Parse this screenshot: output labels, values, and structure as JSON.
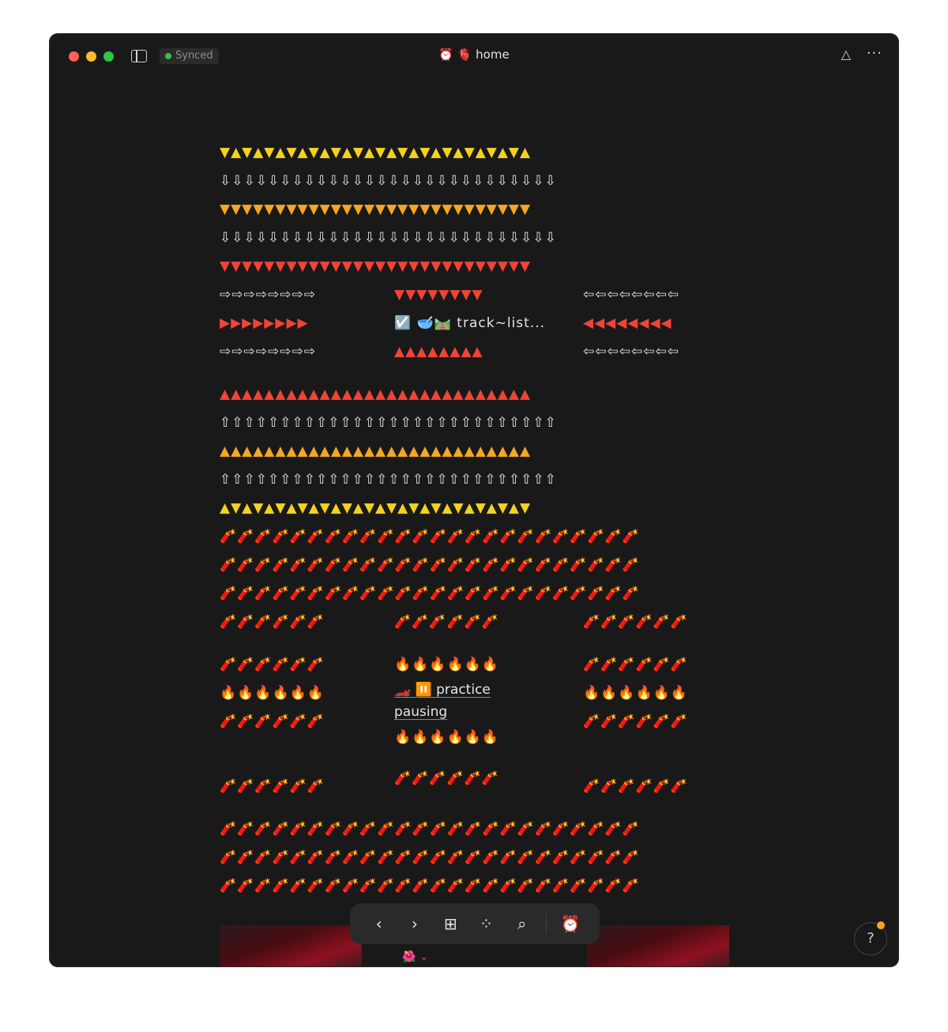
{
  "window": {
    "sync_status": "Synced",
    "title": "⏰ 🫀 home",
    "graph_icon": "△",
    "more_icon": "···"
  },
  "rows_top": [
    {
      "color": "yellow",
      "text": "▼▲▼▲▼▲▼▲▼▲▼▲▼▲▼▲▼▲▼▲▼▲▼▲▼▲▼▲"
    },
    {
      "color": "white",
      "text": "⇩⇩⇩⇩⇩⇩⇩⇩⇩⇩⇩⇩⇩⇩⇩⇩⇩⇩⇩⇩⇩⇩⇩⇩⇩⇩⇩⇩"
    },
    {
      "color": "orange",
      "text": "▼▼▼▼▼▼▼▼▼▼▼▼▼▼▼▼▼▼▼▼▼▼▼▼▼▼▼▼"
    },
    {
      "color": "white",
      "text": "⇩⇩⇩⇩⇩⇩⇩⇩⇩⇩⇩⇩⇩⇩⇩⇩⇩⇩⇩⇩⇩⇩⇩⇩⇩⇩⇩⇩"
    },
    {
      "color": "red",
      "text": "▼▼▼▼▼▼▼▼▼▼▼▼▼▼▼▼▼▼▼▼▼▼▼▼▼▼▼▼"
    }
  ],
  "nav_block": {
    "left": [
      "⇨⇨⇨⇨⇨⇨⇨⇨",
      "▶▶▶▶▶▶▶▶",
      "⇨⇨⇨⇨⇨⇨⇨⇨"
    ],
    "mid_top": "▼▼▼▼▼▼▼▼",
    "mid_link": "☑️ 🥣🛤️ track~list...",
    "mid_bottom": "▲▲▲▲▲▲▲▲",
    "right": [
      "⇦⇦⇦⇦⇦⇦⇦⇦",
      "◀◀◀◀◀◀◀◀",
      "⇦⇦⇦⇦⇦⇦⇦⇦"
    ]
  },
  "rows_mid": [
    {
      "color": "red",
      "text": "▲▲▲▲▲▲▲▲▲▲▲▲▲▲▲▲▲▲▲▲▲▲▲▲▲▲▲▲"
    },
    {
      "color": "white",
      "text": "⇧⇧⇧⇧⇧⇧⇧⇧⇧⇧⇧⇧⇧⇧⇧⇧⇧⇧⇧⇧⇧⇧⇧⇧⇧⇧⇧⇧"
    },
    {
      "color": "orange",
      "text": "▲▲▲▲▲▲▲▲▲▲▲▲▲▲▲▲▲▲▲▲▲▲▲▲▲▲▲▲"
    },
    {
      "color": "white",
      "text": "⇧⇧⇧⇧⇧⇧⇧⇧⇧⇧⇧⇧⇧⇧⇧⇧⇧⇧⇧⇧⇧⇧⇧⇧⇧⇧⇧⇧"
    },
    {
      "color": "yellow",
      "text": "▲▼▲▼▲▼▲▼▲▼▲▼▲▼▲▼▲▼▲▼▲▼▲▼▲▼▲▼"
    },
    {
      "color": "red",
      "text": "🧨🧨🧨🧨🧨🧨🧨🧨🧨🧨🧨🧨🧨🧨🧨🧨🧨🧨🧨🧨🧨🧨🧨🧨"
    },
    {
      "color": "red",
      "text": "🧨🧨🧨🧨🧨🧨🧨🧨🧨🧨🧨🧨🧨🧨🧨🧨🧨🧨🧨🧨🧨🧨🧨🧨"
    },
    {
      "color": "red",
      "text": "🧨🧨🧨🧨🧨🧨🧨🧨🧨🧨🧨🧨🧨🧨🧨🧨🧨🧨🧨🧨🧨🧨🧨🧨"
    }
  ],
  "practice_block": {
    "left": [
      "🧨🧨🧨🧨🧨🧨",
      "",
      "🧨🧨🧨🧨🧨🧨",
      "🔥🔥🔥🔥🔥🔥",
      "🧨🧨🧨🧨🧨🧨",
      "",
      "🧨🧨🧨🧨🧨🧨"
    ],
    "mid_top": "🧨🧨🧨🧨🧨🧨",
    "mid_fire_top": "🔥🔥🔥🔥🔥🔥",
    "mid_link_1": "🏎️ ⏸️ practice",
    "mid_link_2": "pausing",
    "mid_fire_bottom": "🔥🔥🔥🔥🔥🔥",
    "mid_bottom": "🧨🧨🧨🧨🧨🧨",
    "right": [
      "🧨🧨🧨🧨🧨🧨",
      "",
      "🧨🧨🧨🧨🧨🧨",
      "🔥🔥🔥🔥🔥🔥",
      "🧨🧨🧨🧨🧨🧨",
      "",
      "🧨🧨🧨🧨🧨🧨"
    ]
  },
  "rows_bottom": [
    {
      "color": "red",
      "text": "🧨🧨🧨🧨🧨🧨🧨🧨🧨🧨🧨🧨🧨🧨🧨🧨🧨🧨🧨🧨🧨🧨🧨🧨"
    },
    {
      "color": "red",
      "text": "🧨🧨🧨🧨🧨🧨🧨🧨🧨🧨🧨🧨🧨🧨🧨🧨🧨🧨🧨🧨🧨🧨🧨🧨"
    },
    {
      "color": "red",
      "text": "🧨🧨🧨🧨🧨🧨🧨🧨🧨🧨🧨🧨🧨🧨🧨🧨🧨🧨🧨🧨🧨🧨🧨🧨"
    }
  ],
  "dock": {
    "back": "‹",
    "forward": "›",
    "new": "⊞",
    "graph": "⁘",
    "search": "⌕",
    "alarm": "⏰"
  },
  "help": "?",
  "peek_text": "🌺 ⌄"
}
